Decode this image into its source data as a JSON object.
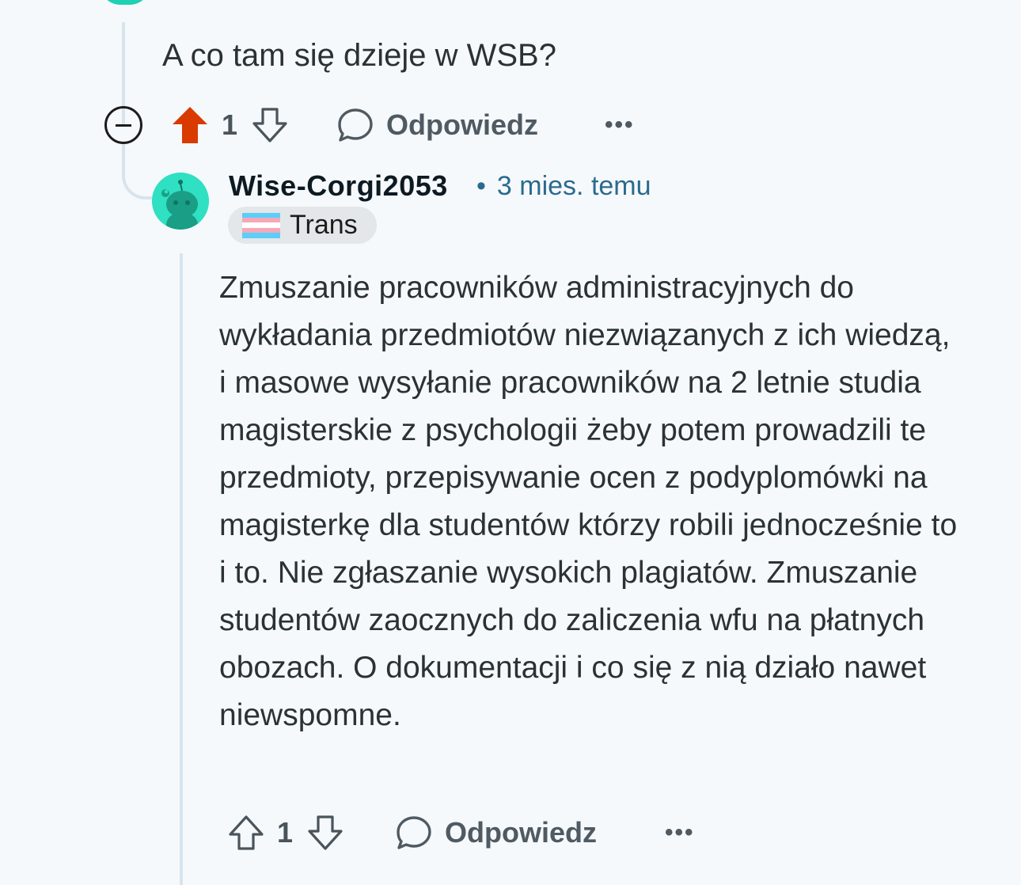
{
  "parent_comment": {
    "text": "A co tam się dzieje w WSB?",
    "vote_count": "1",
    "upvoted": true,
    "reply_label": "Odpowiedz",
    "more_label": "•••"
  },
  "reply_comment": {
    "username": "Wise-Corgi2053",
    "separator": "•",
    "timestamp": "3 mies. temu",
    "flair": {
      "text": "Trans",
      "flag_colors": [
        "#5bcefa",
        "#f5a9b8",
        "#ffffff",
        "#f5a9b8",
        "#5bcefa"
      ]
    },
    "body": "Zmuszanie pracowników administracyjnych do wykładania przedmiotów niezwiązanych z ich wiedzą, i masowe wysyłanie pracowników na 2 letnie studia magisterskie z psychologii żeby potem prowadzili te przedmioty, przepisywanie ocen z podyplomówki na magisterkę dla studentów którzy robili jednocześnie to i to. Nie zgłaszanie wysokich plagiatów. Zmuszanie studentów zaocznych do zaliczenia wfu na płatnych obozach. O dokumentacji i co się z nią działo nawet niewspomne.",
    "vote_count": "1",
    "reply_label": "Odpowiedz",
    "more_label": "•••"
  },
  "colors": {
    "upvote_active": "#d93a00",
    "avatar_bg": "#2fe0c2",
    "thread_line": "#d7e4ee",
    "meta_text": "#2b6a8e"
  }
}
